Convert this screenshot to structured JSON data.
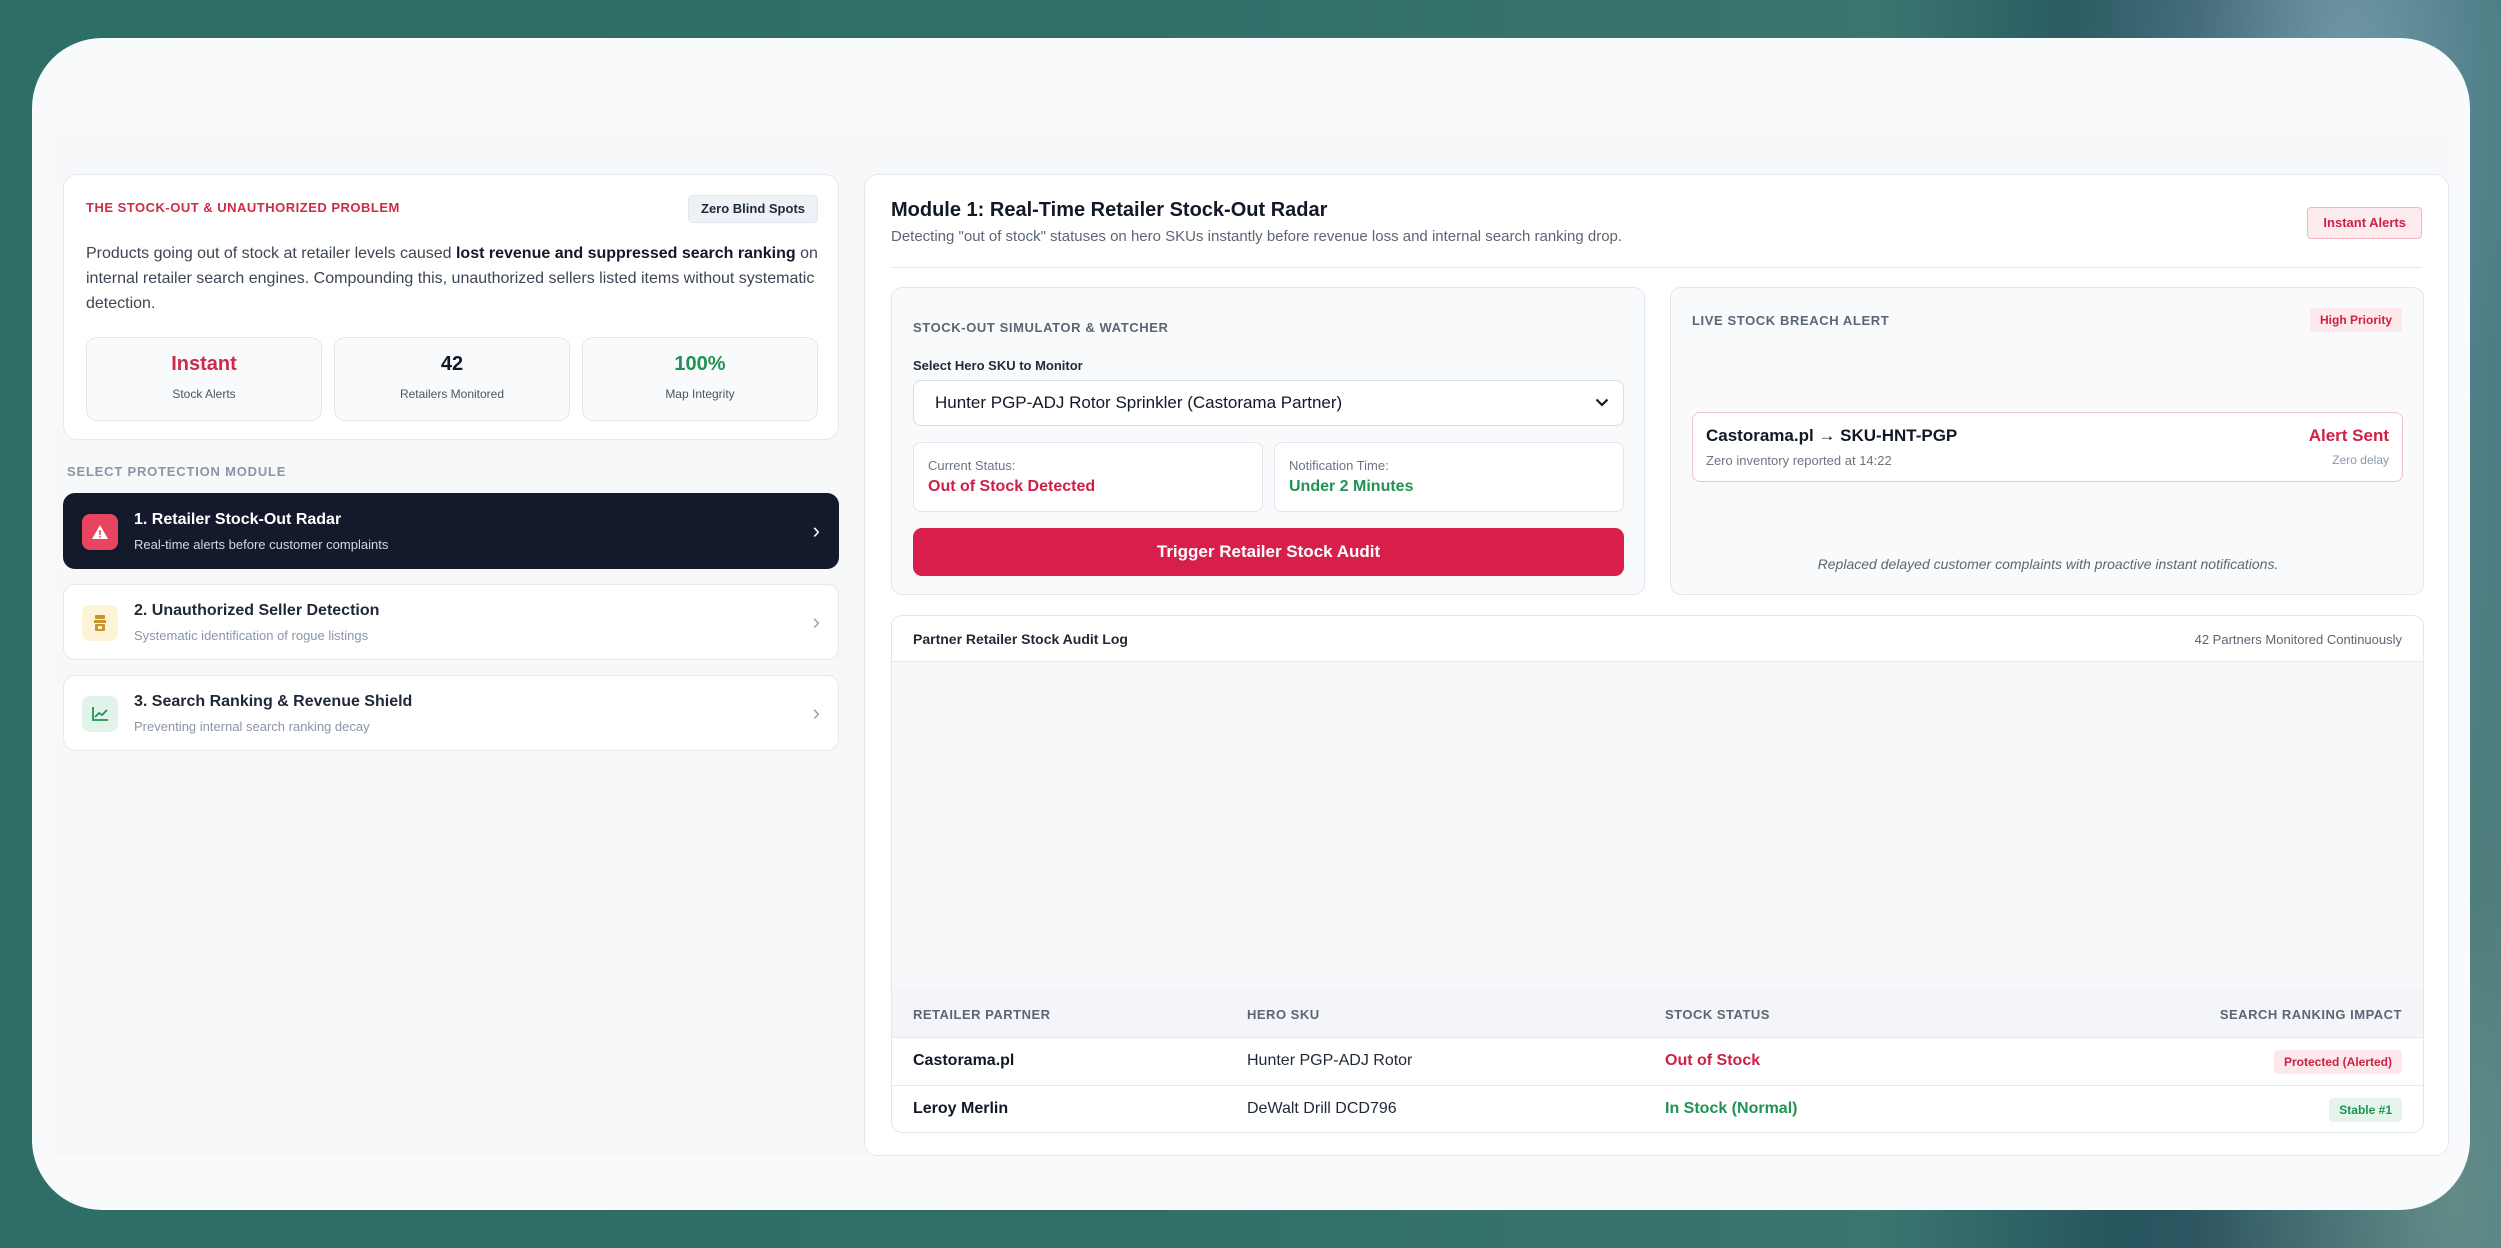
{
  "problem": {
    "title": "THE STOCK-OUT & UNAUTHORIZED PROBLEM",
    "badge": "Zero Blind Spots",
    "text_before": "Products going out of stock at retailer levels caused ",
    "text_bold": "lost revenue and suppressed search ranking",
    "text_after": " on internal retailer search engines. Compounding this, unauthorized sellers listed items without systematic detection.",
    "stats": [
      {
        "value": "Instant",
        "label": "Stock Alerts",
        "color": "#d02a4a"
      },
      {
        "value": "42",
        "label": "Retailers Monitored",
        "color": "#111827"
      },
      {
        "value": "100%",
        "label": "Map Integrity",
        "color": "#1f9254"
      }
    ]
  },
  "modules": {
    "section_label": "SELECT PROTECTION MODULE",
    "items": [
      {
        "title": "1. Retailer Stock-Out Radar",
        "subtitle": "Real-time alerts before customer complaints",
        "icon": "warning-icon"
      },
      {
        "title": "2. Unauthorized Seller Detection",
        "subtitle": "Systematic identification of rogue listings",
        "icon": "seller-icon"
      },
      {
        "title": "3. Search Ranking & Revenue Shield",
        "subtitle": "Preventing internal search ranking decay",
        "icon": "chart-icon"
      }
    ]
  },
  "main": {
    "heading": "Module 1: Real-Time Retailer Stock-Out Radar",
    "description": "Detecting \"out of stock\" statuses on hero SKUs instantly before revenue loss and internal search ranking drop.",
    "badge": "Instant Alerts"
  },
  "simulator": {
    "title": "STOCK-OUT SIMULATOR & WATCHER",
    "select_label": "Select Hero SKU to Monitor",
    "select_value": "Hunter PGP-ADJ Rotor Sprinkler (Castorama Partner)",
    "status_label": "Current Status:",
    "status_value": "Out of Stock Detected",
    "notif_label": "Notification Time:",
    "notif_value": "Under 2 Minutes",
    "button": "Trigger Retailer Stock Audit"
  },
  "alert": {
    "title": "LIVE STOCK BREACH ALERT",
    "priority": "High Priority",
    "main": "Castorama.pl → SKU-HNT-PGP",
    "sub": "Zero inventory reported at 14:22",
    "status": "Alert Sent",
    "delay": "Zero delay",
    "note": "Replaced delayed customer complaints with proactive instant notifications."
  },
  "log": {
    "title": "Partner Retailer Stock Audit Log",
    "count": "42 Partners Monitored Continuously",
    "headers": [
      "RETAILER PARTNER",
      "HERO SKU",
      "STOCK STATUS",
      "SEARCH RANKING IMPACT"
    ],
    "rows": [
      {
        "retailer": "Castorama.pl",
        "sku": "Hunter PGP-ADJ Rotor",
        "status": "Out of Stock",
        "status_color": "#cf1f45",
        "impact": "Protected (Alerted)",
        "impact_bg": "#fde8eb",
        "impact_color": "#cf1f45"
      },
      {
        "retailer": "Leroy Merlin",
        "sku": "DeWalt Drill DCD796",
        "status": "In Stock (Normal)",
        "status_color": "#1f9254",
        "impact": "Stable #1",
        "impact_bg": "#e3f5ea",
        "impact_color": "#1f9254"
      }
    ]
  }
}
